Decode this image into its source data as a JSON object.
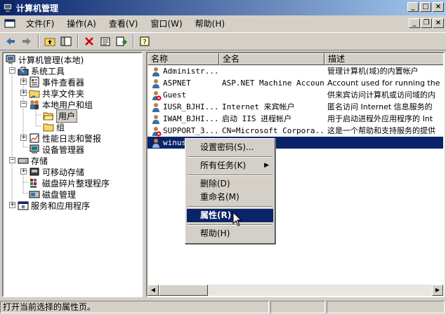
{
  "window": {
    "title": "计算机管理"
  },
  "menubar": {
    "items": [
      "文件(F)",
      "操作(A)",
      "查看(V)",
      "窗口(W)",
      "帮助(H)"
    ]
  },
  "toolbar": {
    "icons": [
      "back-icon",
      "forward-icon",
      "up-folder-icon",
      "show-hide-tree-icon",
      "delete-icon",
      "properties-icon",
      "export-list-icon",
      "help-icon"
    ]
  },
  "tree": {
    "root": "计算机管理(本地)",
    "system_tools": "系统工具",
    "event_viewer": "事件查看器",
    "shared_folders": "共享文件夹",
    "local_users_groups": "本地用户和组",
    "users": "用户",
    "groups": "组",
    "perf_logs": "性能日志和警报",
    "device_manager": "设备管理器",
    "storage": "存储",
    "removable_storage": "可移动存储",
    "defrag": "磁盘碎片整理程序",
    "disk_mgmt": "磁盘管理",
    "services_apps": "服务和应用程序"
  },
  "list": {
    "columns": [
      "名称",
      "全名",
      "描述"
    ],
    "rows": [
      {
        "name": "Administr...",
        "fullname": "",
        "desc": "管理计算机(域)的内置帐户"
      },
      {
        "name": "ASPNET",
        "fullname": "ASP.NET Machine Account",
        "desc": "Account used for running the"
      },
      {
        "name": "Guest",
        "fullname": "",
        "desc": "供来宾访问计算机或访问域的内"
      },
      {
        "name": "IUSR_BJHI...",
        "fullname": "Internet 来宾帐户",
        "desc": "匿名访问 Internet 信息服务的"
      },
      {
        "name": "IWAM_BJHI...",
        "fullname": "启动 IIS 进程帐户",
        "desc": "用于启动进程外应用程序的 Int"
      },
      {
        "name": "SUPPORT_3...",
        "fullname": "CN=Microsoft Corpora...",
        "desc": "这是一个帮助和支持服务的提供"
      },
      {
        "name": "winuse",
        "fullname": "",
        "desc": ""
      }
    ]
  },
  "context_menu": {
    "set_password": "设置密码(S)...",
    "all_tasks": "所有任务(K)",
    "delete": "删除(D)",
    "rename": "重命名(M)",
    "properties": "属性(R)",
    "help": "帮助(H)"
  },
  "status": {
    "text": "打开当前选择的属性页。"
  },
  "colors": {
    "titlebar": "#0a246a",
    "face": "#d4d0c8",
    "highlight": "#0a246a"
  }
}
